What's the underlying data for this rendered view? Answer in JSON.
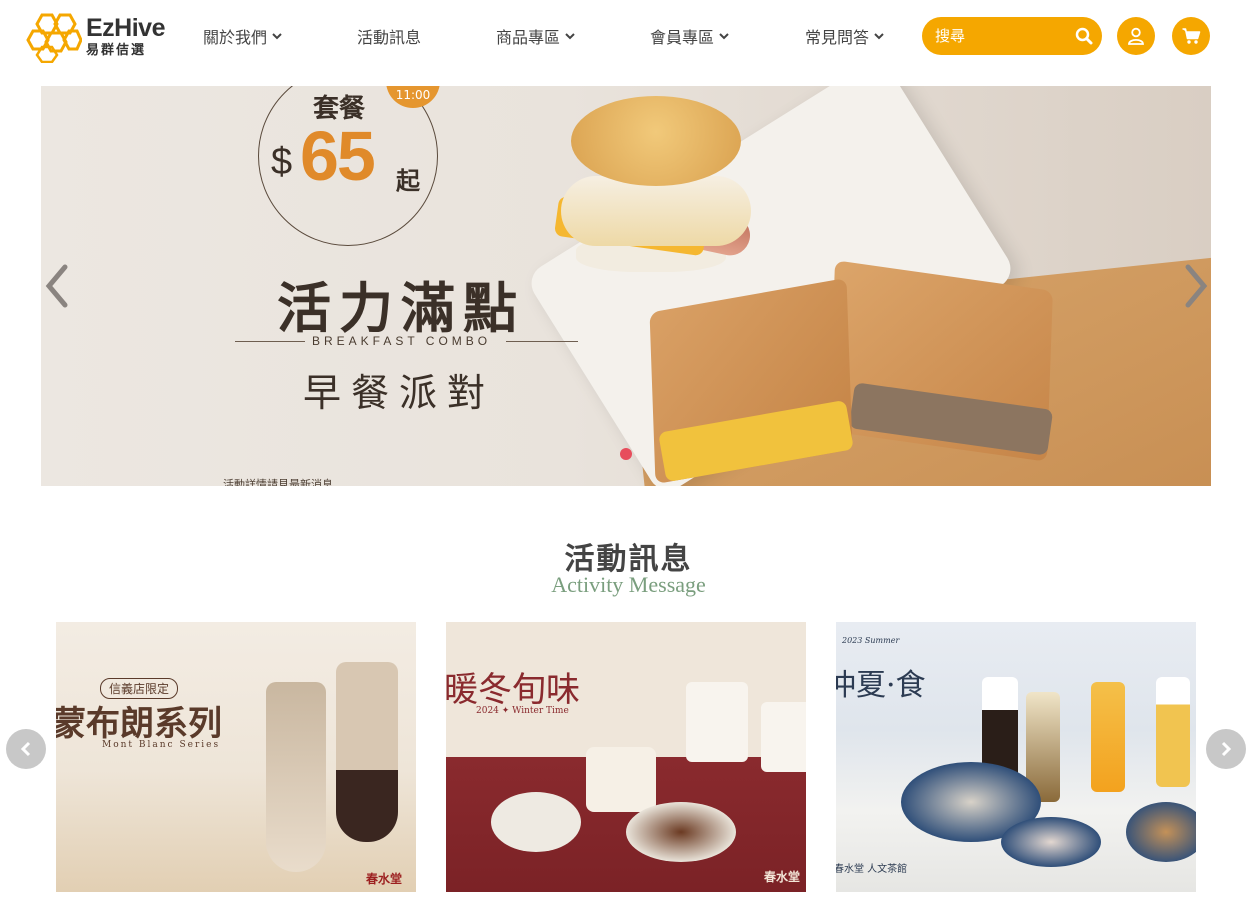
{
  "brand": {
    "name_en": "EzHive",
    "name_zh": "易群佶選",
    "accent": "#f5a700"
  },
  "nav": {
    "items": [
      {
        "label": "關於我們",
        "has_dropdown": true
      },
      {
        "label": "活動訊息",
        "has_dropdown": false
      },
      {
        "label": "商品專區",
        "has_dropdown": true
      },
      {
        "label": "會員專區",
        "has_dropdown": true
      },
      {
        "label": "常見問答",
        "has_dropdown": true
      }
    ]
  },
  "search": {
    "placeholder": "搜尋",
    "icon": "search-icon"
  },
  "actions": {
    "user_icon": "user-icon",
    "cart_icon": "cart-icon"
  },
  "banner": {
    "time_badge": "11:00",
    "combo_label": "套餐",
    "currency": "$",
    "price": "65",
    "price_suffix": "起",
    "headline": "活力滿點",
    "subtitle_en": "BREAKFAST COMBO",
    "subtitle_zh": "早餐派對",
    "fine_print": "活動詳情請見最新消息",
    "active_slide": 1,
    "prev_icon": "chevron-left-icon",
    "next_icon": "chevron-right-icon"
  },
  "activity": {
    "title": "活動訊息",
    "subtitle": "Activity Message",
    "cards": [
      {
        "tag": "信義店限定",
        "title": "蒙布朗系列",
        "caption": "Mont Blanc Series",
        "brand": "春水堂"
      },
      {
        "title": "暖冬旬味",
        "caption": "2024 ✦ Winter Time",
        "brand": "春水堂"
      },
      {
        "title": "仲夏·食",
        "caption": "2023 Summer",
        "brand": "春水堂 人文茶館"
      }
    ]
  }
}
